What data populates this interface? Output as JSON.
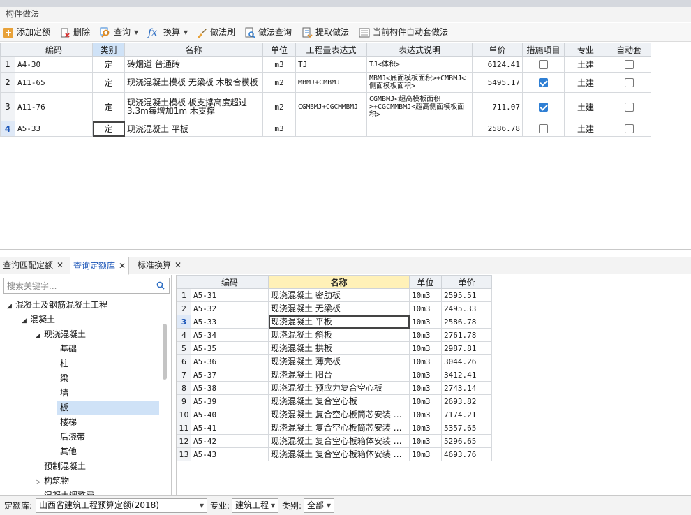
{
  "panel": {
    "title": "构件做法"
  },
  "toolbar": {
    "add_quota": "添加定额",
    "delete": "删除",
    "query": "查询",
    "convert": "换算",
    "method_brush": "做法刷",
    "method_query": "做法查询",
    "extract_method": "提取做法",
    "auto_apply": "当前构件自动套做法"
  },
  "upper_table": {
    "headers": {
      "code": "编码",
      "category": "类别",
      "name": "名称",
      "unit": "单位",
      "expr": "工程量表达式",
      "desc": "表达式说明",
      "price": "单价",
      "measure": "措施项目",
      "specialty": "专业",
      "auto": "自动套"
    },
    "rows": [
      {
        "num": "1",
        "code": "A4-30",
        "category": "定",
        "name": "砖烟道 普通砖",
        "unit": "m3",
        "expr": "TJ",
        "desc": "TJ<体积>",
        "price": "6124.41",
        "measure": false,
        "specialty": "土建",
        "auto": false
      },
      {
        "num": "2",
        "code": "A11-65",
        "category": "定",
        "name": "现浇混凝土模板 无梁板 木胶合模板",
        "unit": "m2",
        "expr": "MBMJ+CMBMJ",
        "desc": "MBMJ<底面模板面积>+CMBMJ<侧面模板面积>",
        "price": "5495.17",
        "measure": true,
        "specialty": "土建",
        "auto": false
      },
      {
        "num": "3",
        "code": "A11-76",
        "category": "定",
        "name": "现浇混凝土模板 板支撑高度超过3.3m每增加1m 木支撑",
        "unit": "m2",
        "expr": "CGMBMJ+CGCMMBMJ",
        "desc": "CGMBMJ<超高模板面积>+CGCMMBMJ<超高侧面模板面积>",
        "price": "711.07",
        "measure": true,
        "specialty": "土建",
        "auto": false
      },
      {
        "num": "4",
        "code": "A5-33",
        "category": "定",
        "name": "现浇混凝土 平板",
        "unit": "m3",
        "expr": "",
        "desc": "",
        "price": "2586.78",
        "measure": false,
        "specialty": "土建",
        "auto": false
      }
    ]
  },
  "tabs": [
    {
      "label": "查询匹配定额",
      "active": false
    },
    {
      "label": "查询定额库",
      "active": true
    },
    {
      "label": "标准换算",
      "active": false
    }
  ],
  "search": {
    "placeholder": "搜索关键字..."
  },
  "tree": {
    "n0": "混凝土及钢筋混凝土工程",
    "n1": "混凝土",
    "n2": "现浇混凝土",
    "n3": "基础",
    "n4": "柱",
    "n5": "梁",
    "n6": "墙",
    "n7": "板",
    "n8": "楼梯",
    "n9": "后浇带",
    "n10": "其他",
    "n11": "预制混凝土",
    "n12": "构筑物",
    "n13": "混凝土调整费"
  },
  "lower_table": {
    "headers": {
      "code": "编码",
      "name": "名称",
      "unit": "单位",
      "price": "单价"
    },
    "rows": [
      {
        "num": "1",
        "code": "A5-31",
        "name": "现浇混凝土 密肋板",
        "unit": "10m3",
        "price": "2595.51"
      },
      {
        "num": "2",
        "code": "A5-32",
        "name": "现浇混凝土 无梁板",
        "unit": "10m3",
        "price": "2495.33"
      },
      {
        "num": "3",
        "code": "A5-33",
        "name": "现浇混凝土 平板",
        "unit": "10m3",
        "price": "2586.78"
      },
      {
        "num": "4",
        "code": "A5-34",
        "name": "现浇混凝土 斜板",
        "unit": "10m3",
        "price": "2761.78"
      },
      {
        "num": "5",
        "code": "A5-35",
        "name": "现浇混凝土 拱板",
        "unit": "10m3",
        "price": "2987.81"
      },
      {
        "num": "6",
        "code": "A5-36",
        "name": "现浇混凝土 薄壳板",
        "unit": "10m3",
        "price": "3044.26"
      },
      {
        "num": "7",
        "code": "A5-37",
        "name": "现浇混凝土 阳台",
        "unit": "10m3",
        "price": "3412.41"
      },
      {
        "num": "8",
        "code": "A5-38",
        "name": "现浇混凝土 预应力复合空心板",
        "unit": "10m3",
        "price": "2743.14"
      },
      {
        "num": "9",
        "code": "A5-39",
        "name": "现浇混凝土 复合空心板",
        "unit": "10m3",
        "price": "2693.82"
      },
      {
        "num": "10",
        "code": "A5-40",
        "name": "现浇混凝土 复合空心板筒芯安装 …",
        "unit": "10m3",
        "price": "7174.21"
      },
      {
        "num": "11",
        "code": "A5-41",
        "name": "现浇混凝土 复合空心板筒芯安装 …",
        "unit": "10m3",
        "price": "5357.65"
      },
      {
        "num": "12",
        "code": "A5-42",
        "name": "现浇混凝土 复合空心板箱体安装 …",
        "unit": "10m3",
        "price": "5296.65"
      },
      {
        "num": "13",
        "code": "A5-43",
        "name": "现浇混凝土 复合空心板箱体安装 …",
        "unit": "10m3",
        "price": "4693.76"
      }
    ]
  },
  "filters": {
    "lib_label": "定额库:",
    "lib_value": "山西省建筑工程预算定额(2018)",
    "spec_label": "专业:",
    "spec_value": "建筑工程",
    "cat_label": "类别:",
    "cat_value": "全部"
  },
  "colors": {
    "accent": "#2f7fd4",
    "selection": "#cfe2f7",
    "header": "#eef1f5",
    "highlight_header": "#fff1b8"
  }
}
